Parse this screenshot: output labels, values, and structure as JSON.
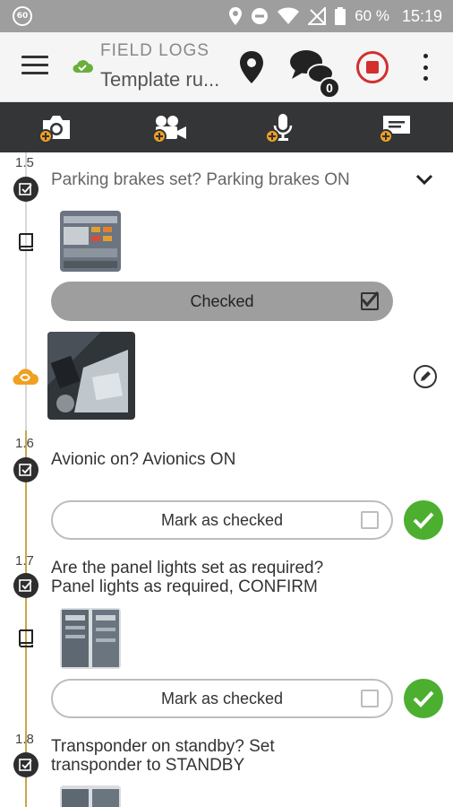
{
  "status_bar": {
    "notification_badge": "60",
    "battery": "60 %",
    "time": "15:19"
  },
  "app_bar": {
    "title": "FIELD LOGS",
    "subtitle": "Template ru...",
    "chat_count": "0",
    "accent": "#d32f2f"
  },
  "media_toolbar": {
    "items": [
      "camera-icon",
      "video-icon",
      "microphone-icon",
      "note-icon"
    ]
  },
  "steps": [
    {
      "number": "1.5",
      "text": "Parking brakes set? Parking brakes ON",
      "button": "Checked",
      "checked": true
    },
    {
      "number": "1.6",
      "text": "Avionic on? Avionics ON",
      "button": "Mark as checked",
      "checked": false
    },
    {
      "number": "1.7",
      "text_line1": "Are the panel lights set as required?",
      "text_line2": "Panel lights as required, CONFIRM",
      "button": "Mark as checked",
      "checked": false
    },
    {
      "number": "1.8",
      "text_line1": "Transponder on standby? Set",
      "text_line2": "transponder to STANDBY"
    }
  ],
  "colors": {
    "timeline": "#c9a64a",
    "ok": "#4caf2f",
    "sync": "#f0a020"
  }
}
